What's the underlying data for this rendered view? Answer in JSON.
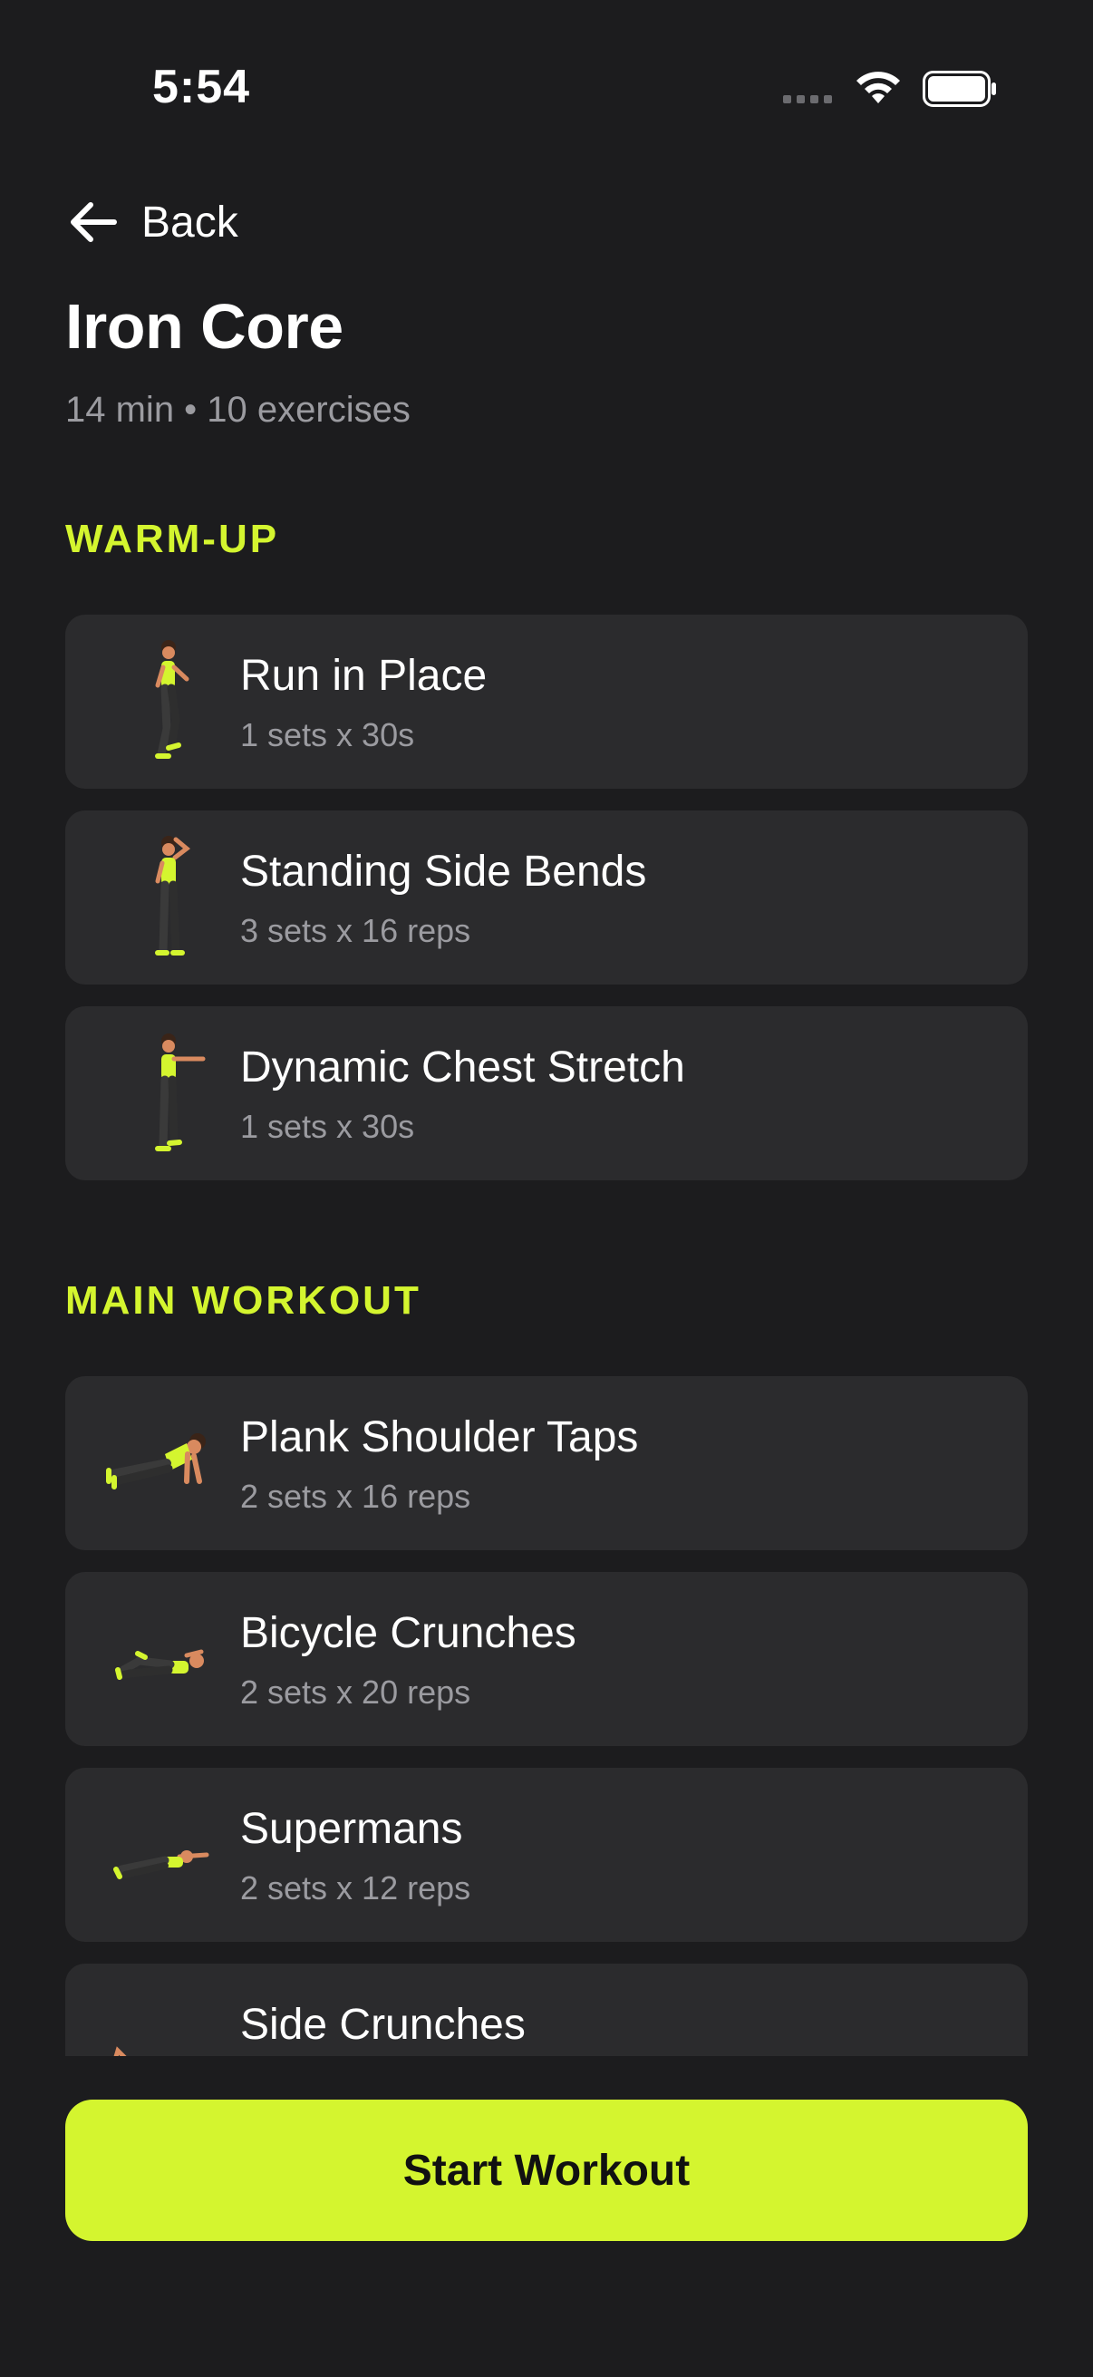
{
  "status_bar": {
    "time": "5:54"
  },
  "nav": {
    "back_label": "Back"
  },
  "workout": {
    "title": "Iron Core",
    "subtitle": "14 min • 10 exercises"
  },
  "sections": {
    "warmup_title": "WARM-UP",
    "main_title": "MAIN WORKOUT"
  },
  "warmup_exercises": [
    {
      "name": "Run in Place",
      "detail": "1 sets x 30s"
    },
    {
      "name": "Standing Side Bends",
      "detail": "3 sets x 16 reps"
    },
    {
      "name": "Dynamic Chest Stretch",
      "detail": "1 sets x 30s"
    }
  ],
  "main_exercises": [
    {
      "name": "Plank Shoulder Taps",
      "detail": "2 sets x 16 reps"
    },
    {
      "name": "Bicycle Crunches",
      "detail": "2 sets x 20 reps"
    },
    {
      "name": "Supermans",
      "detail": "2 sets x 12 reps"
    },
    {
      "name": "Side Crunches",
      "detail": ""
    }
  ],
  "actions": {
    "start_label": "Start Workout"
  },
  "colors": {
    "background": "#1c1c1e",
    "card": "#2b2b2d",
    "accent": "#d4f52f",
    "muted_text": "#9b9ba0"
  }
}
